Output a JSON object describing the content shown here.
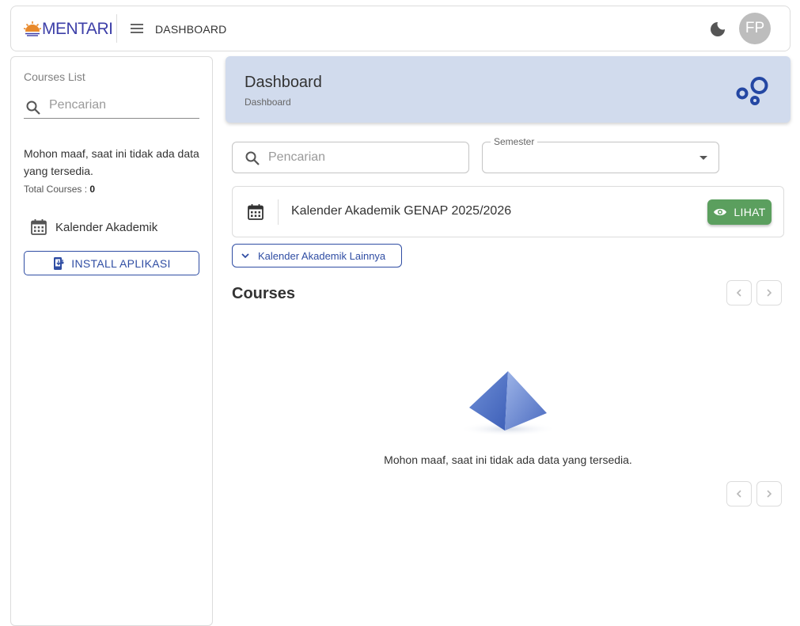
{
  "brand": {
    "name": "MENTARI",
    "color": "#3d3fa8",
    "accent": "#e8892b"
  },
  "topbar": {
    "title": "DASHBOARD",
    "avatar_initials": "FP"
  },
  "sidebar": {
    "heading": "Courses List",
    "search_placeholder": "Pencarian",
    "empty_message": "Mohon maaf, saat ini tidak ada data yang tersedia.",
    "total_label": "Total Courses :",
    "total_value": "0",
    "calendar_link": "Kalender Akademik",
    "install_button": "INSTALL APLIKASI"
  },
  "header_card": {
    "title": "Dashboard",
    "breadcrumb": "Dashboard"
  },
  "filters": {
    "search_placeholder": "Pencarian",
    "semester_label": "Semester",
    "semester_value": ""
  },
  "calendar_card": {
    "text": "Kalender Akademik GENAP 2025/2026",
    "view_button": "LIHAT"
  },
  "other_calendar_button": "Kalender Akademik Lainnya",
  "courses": {
    "title": "Courses",
    "empty_message": "Mohon maaf, saat ini tidak ada data yang tersedia."
  },
  "colors": {
    "primary": "#2f4da3",
    "header_bg": "#d1dbed",
    "success": "#5b9f5e",
    "avatar_bg": "#bdbdbd"
  },
  "icons": [
    "menu-icon",
    "moon-icon",
    "search-icon",
    "calendar-icon",
    "install-app-icon",
    "bubbles-icon",
    "eye-icon",
    "chevron-down-icon",
    "chevron-left-icon",
    "chevron-right-icon"
  ]
}
